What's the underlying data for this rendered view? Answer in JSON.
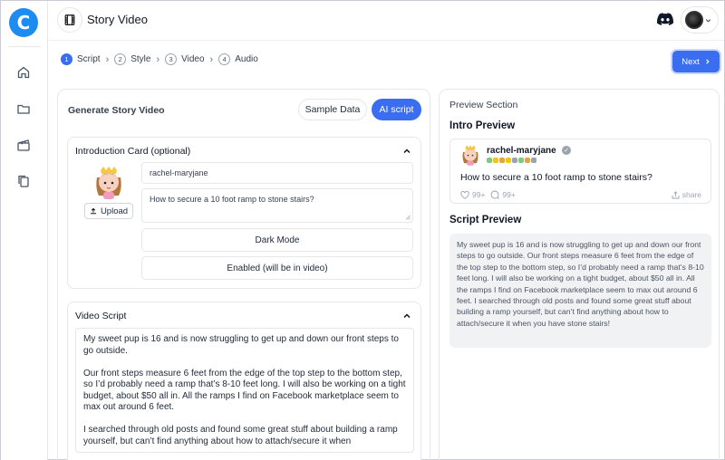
{
  "app": {
    "title": "Story Video",
    "logo_letter": "C"
  },
  "sidebar": {
    "items": [
      {
        "name": "home",
        "icon": "home-icon"
      },
      {
        "name": "folder",
        "icon": "folder-icon"
      },
      {
        "name": "video",
        "icon": "clapperboard-icon"
      },
      {
        "name": "documents",
        "icon": "copy-icon"
      }
    ]
  },
  "header": {
    "discord_icon": "discord-icon",
    "avatar_icon": "user-avatar"
  },
  "steps": [
    {
      "num": "1",
      "label": "Script",
      "active": true
    },
    {
      "num": "2",
      "label": "Style",
      "active": false
    },
    {
      "num": "3",
      "label": "Video",
      "active": false
    },
    {
      "num": "4",
      "label": "Audio",
      "active": false
    }
  ],
  "next_label": "Next",
  "generate": {
    "heading": "Generate Story Video",
    "sample_label": "Sample Data",
    "ai_label": "AI script"
  },
  "intro_card": {
    "title": "Introduction Card (optional)",
    "upload_label": "Upload",
    "username": "rachel-maryjane",
    "question": "How to secure a 10 foot ramp to stone stairs?",
    "dark_mode_label": "Dark Mode",
    "enabled_label": "Enabled (will be in video)"
  },
  "video_script": {
    "title": "Video Script",
    "paragraphs": [
      "My sweet pup is 16 and is now struggling to get up and down our front steps to go outside.",
      "Our front steps measure 6 feet from the edge of the top step to the bottom step, so I’d probably need a ramp that’s 8-10 feet long. I will also be working on a tight budget, about $50 all in. All the ramps I find on Facebook marketplace seem to max out around 6 feet.",
      "I searched through old posts and found some great stuff about building a ramp yourself, but can’t find anything about how to attach/secure it when"
    ]
  },
  "preview": {
    "section_title": "Preview Section",
    "intro_title": "Intro Preview",
    "username": "rachel-maryjane",
    "question": "How to secure a 10 foot ramp to stone stairs?",
    "likes": "99+",
    "comments": "99+",
    "share_label": "share",
    "script_title": "Script Preview",
    "script_text": "My sweet pup is 16 and is now struggling to get up and down our front steps to go outside. Our front steps measure 6 feet from the edge of the top step to the bottom step, so I’d probably need a ramp that’s 8-10 feet long. I will also be working on a tight budget, about $50 all in. All the ramps I find on Facebook marketplace seem to max out around 6 feet. I searched through old posts and found some great stuff about building a ramp yourself, but can’t find anything about how to attach/secure it when you have stone stairs!"
  },
  "colors": {
    "accent": "#3b6df0",
    "logo": "#1d8cf0"
  }
}
